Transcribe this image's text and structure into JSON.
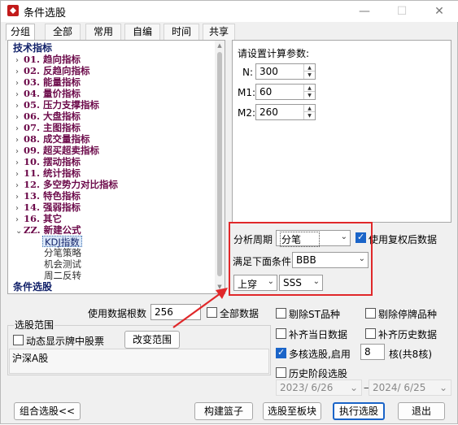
{
  "window": {
    "title": "条件选股"
  },
  "tabs": [
    "分组",
    "全部",
    "常用",
    "自编",
    "时间",
    "共享"
  ],
  "tree": {
    "root_label": "技术指标",
    "categories": [
      "01. 趋向指标",
      "02. 反趋向指标",
      "03. 能量指标",
      "04. 量价指标",
      "05. 压力支撑指标",
      "06. 大盘指标",
      "07. 主图指标",
      "08. 成交量指标",
      "09. 超买超卖指标",
      "10. 摆动指标",
      "11. 统计指标",
      "12. 多空势力对比指标",
      "13. 特色指标",
      "14. 强弱指标",
      "16. 其它"
    ],
    "custom_label": "ZZ. 新建公式",
    "custom_items": [
      "KDJ指数",
      "分笔策略",
      "机会测试",
      "周二反转"
    ],
    "section2_label": "条件选股"
  },
  "params": {
    "heading": "请设置计算参数:",
    "rows": [
      {
        "label": "N:",
        "value": "300"
      },
      {
        "label": "M1:",
        "value": "60"
      },
      {
        "label": "M2:",
        "value": "260"
      }
    ]
  },
  "period": {
    "label": "分析周期",
    "value": "分笔"
  },
  "use_adjusted": {
    "label": "使用复权后数据",
    "checked": true
  },
  "condition": {
    "label": "满足下面条件",
    "value": "BBB"
  },
  "cross": {
    "direction": "上穿",
    "target": "SSS"
  },
  "data_count": {
    "label": "使用数据根数",
    "value": "256"
  },
  "all_data": {
    "label": "全部数据",
    "checked": false
  },
  "options": {
    "exclude_st": {
      "label": "剔除ST品种",
      "checked": false
    },
    "exclude_suspended": {
      "label": "剔除停牌品种",
      "checked": false
    },
    "fill_today": {
      "label": "补齐当日数据",
      "checked": false
    },
    "fill_history": {
      "label": "补齐历史数据",
      "checked": false
    },
    "multicore": {
      "label": "多核选股,启用",
      "checked": true,
      "value": "8",
      "suffix": "核(共8核)"
    },
    "history_stage": {
      "label": "历史阶段选股",
      "checked": false
    }
  },
  "scope": {
    "title": "选股范围",
    "dynamic_label": "动态显示牌中股票",
    "change_button": "改变范围",
    "value": "沪深A股"
  },
  "dates": {
    "start": "2023/ 6/26",
    "separator": "—",
    "end": "2024/ 6/25"
  },
  "buttons": {
    "combo": "组合选股<<",
    "build_basket": "构建篮子",
    "to_sector": "选股至板块",
    "execute": "执行选股",
    "exit": "退出"
  },
  "colors": {
    "highlight_box": "#e0282a",
    "accent": "#1a64c8",
    "category_text": "#6c0a4a"
  }
}
